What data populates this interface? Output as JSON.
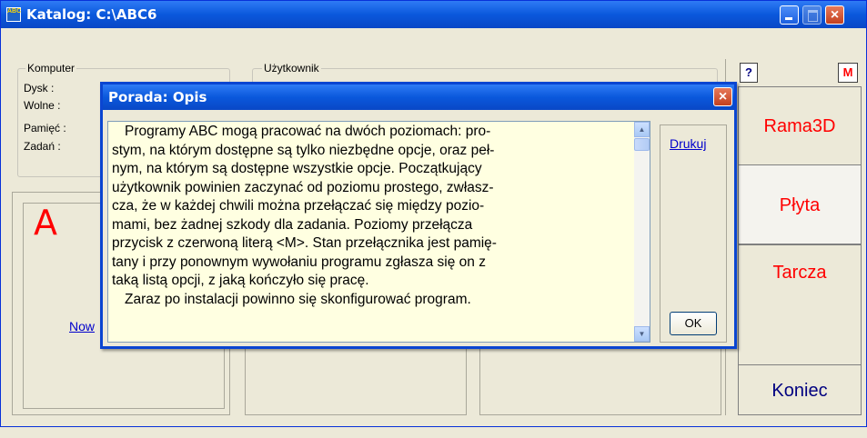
{
  "window": {
    "title": "Katalog: C:\\ABC6",
    "icon_text": "ABC"
  },
  "komputer": {
    "legend": "Komputer",
    "rows": [
      {
        "label": "Dysk :"
      },
      {
        "label": "Wolne :"
      },
      {
        "label": "Pamięć :"
      },
      {
        "label": "Zadań :"
      }
    ]
  },
  "uzytkownik": {
    "legend": "Użytkownik"
  },
  "left_panel": {
    "big_letter": "A",
    "link": "Now"
  },
  "right_buttons": {
    "help": "?",
    "mode": "M",
    "items": [
      {
        "label": "Rama3D"
      },
      {
        "label": "Płyta"
      },
      {
        "label": "Tarcza"
      },
      {
        "label": "Koniec"
      }
    ]
  },
  "dialog": {
    "title": "Porada: Opis",
    "print_link": "Drukuj",
    "ok_label": "OK",
    "lines": [
      "Programy ABC mogą pracować na dwóch poziomach: pro-",
      "stym, na którym dostępne są tylko niezbędne opcje, oraz peł-",
      "nym, na którym są dostępne wszystkie opcje. Początkujący",
      "użytkownik powinien zaczynać od poziomu prostego, zwłasz-",
      "cza, że w każdej chwili można przełączać się między pozio-",
      "mami, bez żadnej szkody dla zadania. Poziomy przełącza",
      "przycisk z czerwoną literą <M>. Stan przełącznika jest pamię-",
      "tany i przy ponownym wywołaniu programu zgłasza się on z",
      "taką listą opcji, z jaką kończyło się pracę.",
      "Zaraz po instalacji powinno się skonfigurować program."
    ]
  }
}
